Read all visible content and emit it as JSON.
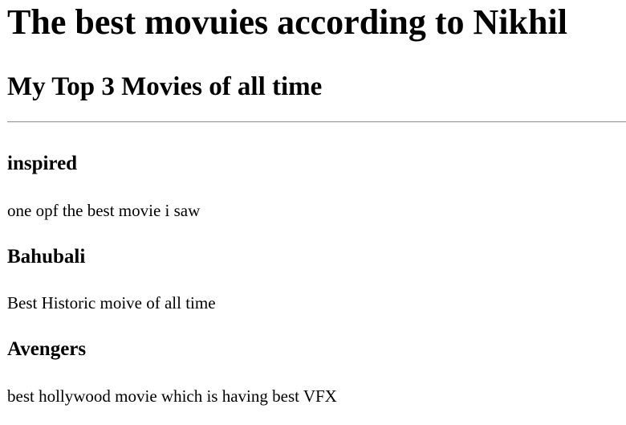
{
  "page": {
    "title": "The best movuies according to Nikhil",
    "subtitle": "My Top 3 Movies of all time"
  },
  "movies": [
    {
      "title": "inspired",
      "description": "one opf the best movie i saw"
    },
    {
      "title": "Bahubali",
      "description": "Best Historic moive of all time"
    },
    {
      "title": "Avengers",
      "description": "best hollywood movie which is having best VFX"
    }
  ]
}
